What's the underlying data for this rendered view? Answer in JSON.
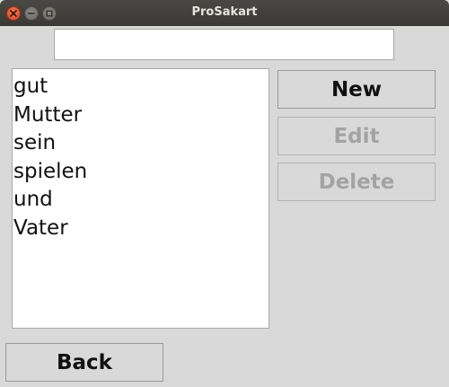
{
  "window": {
    "title": "ProSakart"
  },
  "entry": {
    "value": ""
  },
  "list": {
    "items": [
      "gut",
      "Mutter",
      "sein",
      "spielen",
      "und",
      "Vater"
    ]
  },
  "buttons": {
    "new": "New",
    "edit": "Edit",
    "delete": "Delete",
    "back": "Back"
  },
  "colors": {
    "titlebar": "#3b3935",
    "close_button": "#e3522f",
    "window_bg": "#d9d9d9",
    "disabled_text": "#a3a3a3"
  },
  "icons": [
    "close-icon",
    "minimize-icon",
    "maximize-icon"
  ]
}
